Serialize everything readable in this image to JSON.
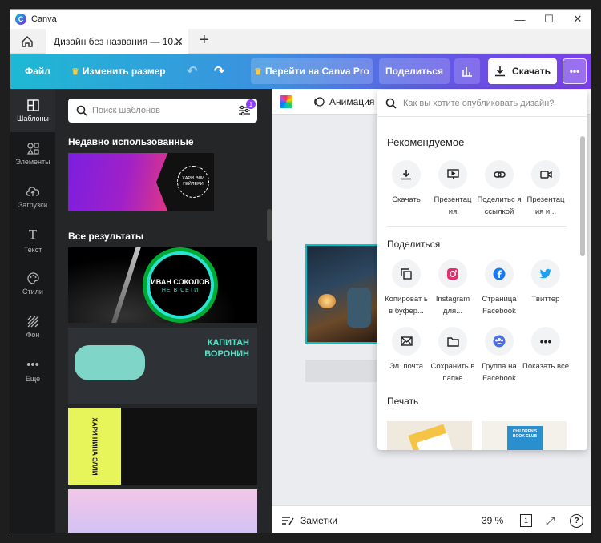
{
  "app": {
    "title": "Canva"
  },
  "tab": {
    "title": "Дизайн без названия — 10..."
  },
  "toolbar": {
    "file": "Файл",
    "resize": "Изменить размер",
    "pro": "Перейти на Canva Pro",
    "share": "Поделиться",
    "download": "Скачать",
    "more": "•••"
  },
  "rail": [
    {
      "label": "Шаблоны"
    },
    {
      "label": "Элементы"
    },
    {
      "label": "Загрузки"
    },
    {
      "label": "Текст"
    },
    {
      "label": "Стили"
    },
    {
      "label": "Фон"
    },
    {
      "label": "Еще"
    }
  ],
  "panel": {
    "search_placeholder": "Поиск шаблонов",
    "filter_badge": "1",
    "recent_title": "Недавно использованные",
    "all_title": "Все результаты",
    "recent_text": "ХАРИ ЭЛИ ГЕЙЛЕРИ",
    "t1_line1": "ИВАН СОКОЛОВ",
    "t1_line2": "НЕ В СЕТИ",
    "t2_line1": "КАПИТАН",
    "t2_line2": "ВОРОНИН",
    "t3_text": "ХАРИ НИНА ЭЛЛИ"
  },
  "canvas": {
    "animation": "Анимация",
    "notes": "Заметки",
    "zoom": "39 %",
    "pages": "1",
    "help": "?"
  },
  "dropdown": {
    "search_placeholder": "Как вы хотите опубликовать дизайн?",
    "recommended_title": "Рекомендуемое",
    "recommended": [
      {
        "label": "Скачать"
      },
      {
        "label": "Презентац ия"
      },
      {
        "label": "Поделитьс я ссылкой"
      },
      {
        "label": "Презентац ия и..."
      }
    ],
    "share_title": "Поделиться",
    "share": [
      {
        "label": "Копироват ь в буфер..."
      },
      {
        "label": "Instagram для..."
      },
      {
        "label": "Страница Facebook"
      },
      {
        "label": "Твиттер"
      },
      {
        "label": "Эл. почта"
      },
      {
        "label": "Сохранить в папке"
      },
      {
        "label": "Группа на Facebook"
      },
      {
        "label": "Показать все"
      }
    ],
    "print_title": "Печать",
    "print_card_text": "CHILDREN'S BOOK CLUB"
  },
  "colors": {
    "toolbar_start": "#1eb9d4",
    "toolbar_end": "#7a3fe8",
    "accent_purple": "#8b3dff",
    "canva_teal": "#00c4cc"
  }
}
